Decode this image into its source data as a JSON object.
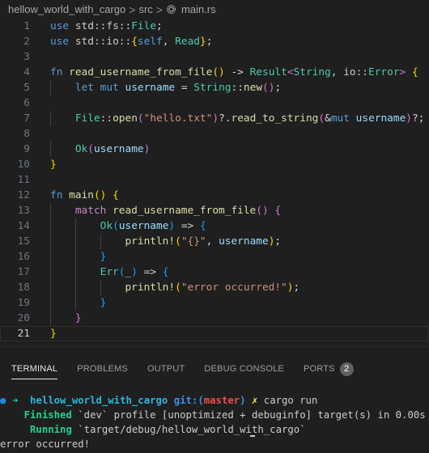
{
  "breadcrumb": {
    "project": "hellow_world_with_cargo",
    "folder": "src",
    "file": "main.rs",
    "file_icon": "rust-gear-icon",
    "separator": ">"
  },
  "editor": {
    "current_line": 21,
    "lines": [
      {
        "n": "1",
        "tokens": [
          [
            "kw",
            "use "
          ],
          [
            "",
            "std::"
          ],
          [
            "",
            "fs::"
          ],
          [
            "ty",
            "File"
          ],
          [
            "punc",
            ";"
          ]
        ]
      },
      {
        "n": "2",
        "tokens": [
          [
            "kw",
            "use "
          ],
          [
            "",
            "std::"
          ],
          [
            "",
            "io::"
          ],
          [
            "b1",
            "{"
          ],
          [
            "kw",
            "self"
          ],
          [
            "punc",
            ", "
          ],
          [
            "ty",
            "Read"
          ],
          [
            "b1",
            "}"
          ],
          [
            "punc",
            ";"
          ]
        ]
      },
      {
        "n": "3",
        "tokens": []
      },
      {
        "n": "4",
        "tokens": [
          [
            "kw",
            "fn "
          ],
          [
            "fn",
            "read_username_from_file"
          ],
          [
            "b1",
            "()"
          ],
          [
            "punc",
            " -> "
          ],
          [
            "ty",
            "Result"
          ],
          [
            "b2",
            "<"
          ],
          [
            "ty",
            "String"
          ],
          [
            "punc",
            ", "
          ],
          [
            "",
            "io::"
          ],
          [
            "ty",
            "Error"
          ],
          [
            "b2",
            ">"
          ],
          [
            "punc",
            " "
          ],
          [
            "b1",
            "{"
          ]
        ]
      },
      {
        "n": "5",
        "tokens": [
          [
            "",
            "    "
          ],
          [
            "kw",
            "let "
          ],
          [
            "kw",
            "mut "
          ],
          [
            "var",
            "username"
          ],
          [
            "punc",
            " = "
          ],
          [
            "ty",
            "String"
          ],
          [
            "punc",
            "::"
          ],
          [
            "fn",
            "new"
          ],
          [
            "b2",
            "()"
          ],
          [
            "punc",
            ";"
          ]
        ]
      },
      {
        "n": "6",
        "tokens": []
      },
      {
        "n": "7",
        "tokens": [
          [
            "",
            "    "
          ],
          [
            "ty",
            "File"
          ],
          [
            "punc",
            "::"
          ],
          [
            "fn",
            "open"
          ],
          [
            "b2",
            "("
          ],
          [
            "str",
            "\"hello.txt\""
          ],
          [
            "b2",
            ")"
          ],
          [
            "punc",
            "?."
          ],
          [
            "fn",
            "read_to_string"
          ],
          [
            "b2",
            "("
          ],
          [
            "punc",
            "&"
          ],
          [
            "kw",
            "mut "
          ],
          [
            "var",
            "username"
          ],
          [
            "b2",
            ")"
          ],
          [
            "punc",
            "?;"
          ]
        ]
      },
      {
        "n": "8",
        "tokens": []
      },
      {
        "n": "9",
        "tokens": [
          [
            "",
            "    "
          ],
          [
            "ty",
            "Ok"
          ],
          [
            "b2",
            "("
          ],
          [
            "var",
            "username"
          ],
          [
            "b2",
            ")"
          ]
        ]
      },
      {
        "n": "10",
        "tokens": [
          [
            "b1",
            "}"
          ]
        ]
      },
      {
        "n": "11",
        "tokens": []
      },
      {
        "n": "12",
        "tokens": [
          [
            "kw",
            "fn "
          ],
          [
            "fn",
            "main"
          ],
          [
            "b1",
            "()"
          ],
          [
            "punc",
            " "
          ],
          [
            "b1",
            "{"
          ]
        ]
      },
      {
        "n": "13",
        "tokens": [
          [
            "",
            "    "
          ],
          [
            "ctl",
            "match "
          ],
          [
            "fn",
            "read_username_from_file"
          ],
          [
            "b2",
            "()"
          ],
          [
            "punc",
            " "
          ],
          [
            "b2",
            "{"
          ]
        ]
      },
      {
        "n": "14",
        "tokens": [
          [
            "",
            "        "
          ],
          [
            "ty",
            "Ok"
          ],
          [
            "b3",
            "("
          ],
          [
            "var",
            "username"
          ],
          [
            "b3",
            ")"
          ],
          [
            "punc",
            " => "
          ],
          [
            "b3",
            "{"
          ]
        ]
      },
      {
        "n": "15",
        "tokens": [
          [
            "",
            "            "
          ],
          [
            "mac",
            "println!"
          ],
          [
            "b1",
            "("
          ],
          [
            "str",
            "\"{}\""
          ],
          [
            "punc",
            ", "
          ],
          [
            "var",
            "username"
          ],
          [
            "b1",
            ")"
          ],
          [
            "punc",
            ";"
          ]
        ]
      },
      {
        "n": "16",
        "tokens": [
          [
            "",
            "        "
          ],
          [
            "b3",
            "}"
          ]
        ]
      },
      {
        "n": "17",
        "tokens": [
          [
            "",
            "        "
          ],
          [
            "ty",
            "Err"
          ],
          [
            "b3",
            "("
          ],
          [
            "var",
            "_"
          ],
          [
            "b3",
            ")"
          ],
          [
            "punc",
            " => "
          ],
          [
            "b3",
            "{"
          ]
        ]
      },
      {
        "n": "18",
        "tokens": [
          [
            "",
            "            "
          ],
          [
            "mac",
            "println!"
          ],
          [
            "b1",
            "("
          ],
          [
            "str",
            "\"error occurred!\""
          ],
          [
            "b1",
            ")"
          ],
          [
            "punc",
            ";"
          ]
        ]
      },
      {
        "n": "19",
        "tokens": [
          [
            "",
            "        "
          ],
          [
            "b3",
            "}"
          ]
        ]
      },
      {
        "n": "20",
        "tokens": [
          [
            "",
            "    "
          ],
          [
            "b2",
            "}"
          ]
        ]
      },
      {
        "n": "21",
        "tokens": [
          [
            "b1",
            "}"
          ]
        ]
      }
    ]
  },
  "panel": {
    "tabs": [
      {
        "label": "TERMINAL",
        "active": true
      },
      {
        "label": "PROBLEMS",
        "active": false
      },
      {
        "label": "OUTPUT",
        "active": false
      },
      {
        "label": "DEBUG CONSOLE",
        "active": false
      },
      {
        "label": "PORTS",
        "active": false,
        "badge": "2"
      }
    ]
  },
  "terminal": {
    "prompt": {
      "dot": "●",
      "arrow": "➜",
      "dir": "hellow_world_with_cargo",
      "git": "git:(",
      "branch": "master",
      "git_close": ")",
      "dirty": "✗",
      "command": "cargo run"
    },
    "finished": {
      "label": "Finished",
      "text": "`dev` profile [unoptimized + debuginfo] target(s) in 0.00s"
    },
    "running": {
      "label": "Running",
      "text": "`target/debug/hellow_world_with_cargo`"
    },
    "output": "error occurred!"
  },
  "colors": {
    "editor_bg": "#1f1f1f",
    "keyword": "#569cd6",
    "control": "#c586c0",
    "function": "#dcdcaa",
    "type": "#4ec9b0",
    "variable": "#9cdcfe",
    "string": "#ce9178",
    "bracket1": "#ffd700",
    "bracket2": "#da70d6",
    "bracket3": "#179fff"
  }
}
